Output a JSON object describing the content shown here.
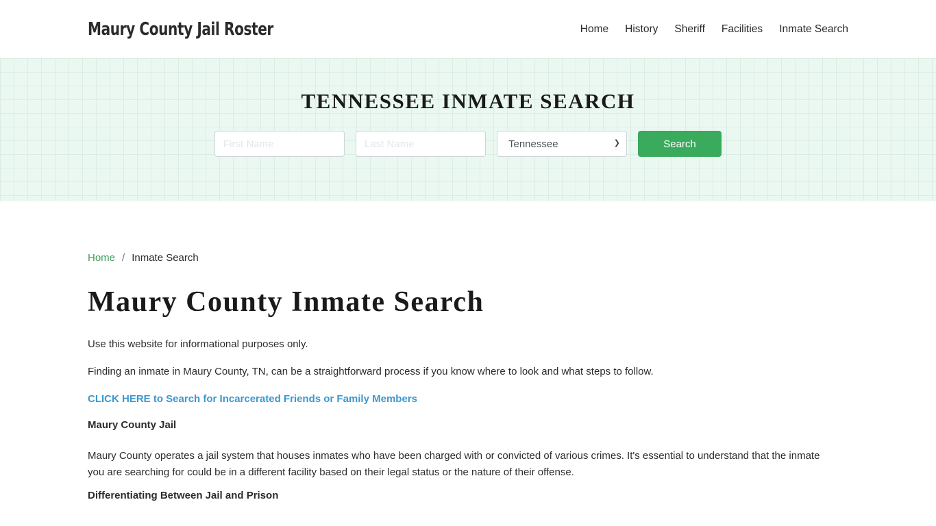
{
  "header": {
    "brand": "Maury County Jail Roster",
    "nav": [
      {
        "label": "Home"
      },
      {
        "label": "History"
      },
      {
        "label": "Sheriff"
      },
      {
        "label": "Facilities"
      },
      {
        "label": "Inmate Search"
      }
    ]
  },
  "hero": {
    "title": "TENNESSEE INMATE SEARCH",
    "first_name_placeholder": "First Name",
    "last_name_placeholder": "Last Name",
    "state_selected": "Tennessee",
    "search_button": "Search"
  },
  "breadcrumb": {
    "home": "Home",
    "separator": "/",
    "current": "Inmate Search"
  },
  "main": {
    "title": "Maury County Inmate Search",
    "intro": "Use this website for informational purposes only.",
    "paragraph1": "Finding an inmate in Maury County, TN, can be a straightforward process if you know where to look and what steps to follow.",
    "cta_link": "CLICK HERE to Search for Incarcerated Friends or Family Members",
    "section1_heading": "Maury County Jail",
    "section1_body": "Maury County operates a jail system that houses inmates who have been charged with or convicted of various crimes. It's essential to understand that the inmate you are searching for could be in a different facility based on their legal status or the nature of their offense.",
    "section2_heading": "Differentiating Between Jail and Prison"
  },
  "colors": {
    "accent_green": "#3aaa5c",
    "link_blue": "#3b98d0",
    "hero_bg": "#eaf8f1"
  }
}
